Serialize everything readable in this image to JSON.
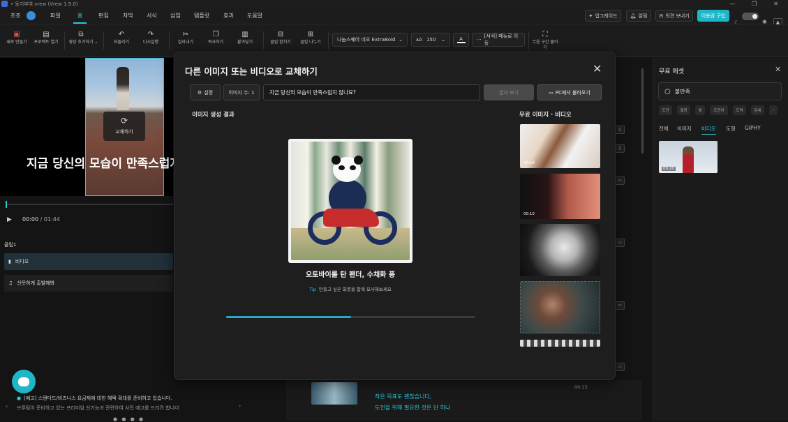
{
  "window": {
    "title": "• 동기부여.vrew (Vrew 1.9.0)"
  },
  "menu": {
    "user": "조조",
    "items": [
      "파일",
      "홈",
      "편집",
      "자막",
      "서식",
      "삽입",
      "템플릿",
      "효과",
      "도움말"
    ],
    "active_index": 1,
    "right_buttons": [
      "업그레이드",
      "알림",
      "의견 보내기",
      "이용권 구입"
    ]
  },
  "toolbar": {
    "tools": [
      {
        "label": "새로 만들기",
        "icon": "new-project"
      },
      {
        "label": "프로젝트 열기",
        "icon": "open-folder"
      },
      {
        "label": "영상 추가하기",
        "icon": "add-video"
      },
      {
        "label": "되돌리기",
        "icon": "undo"
      },
      {
        "label": "다시실행",
        "icon": "redo"
      },
      {
        "label": "잘라내기",
        "icon": "cut"
      },
      {
        "label": "복사하기",
        "icon": "copy"
      },
      {
        "label": "붙여넣기",
        "icon": "paste"
      },
      {
        "label": "클립 합치기",
        "icon": "merge"
      },
      {
        "label": "클립 나누기",
        "icon": "split"
      },
      {
        "label": "무음 구간 줄이기",
        "icon": "shrink-silence"
      }
    ],
    "font_name": "나눔스퀘어 네오 ExtraBold",
    "font_size": "150",
    "more_label": "[서식] 메뉴로 이동"
  },
  "editor": {
    "subtitle_text": "지금 당신의 모습이 만족스럽지",
    "replace_chip_label": "교체하기",
    "current_time": "00:00",
    "total_time": "/ 01:44",
    "clip_group": "클립1",
    "clip_rows": [
      "비디오",
      "산뜻하게 출발해봐"
    ]
  },
  "notice": {
    "line1": "[예고] 스탠다드/비즈니스 요금제에 대한 혜택 확대를 준비하고 있습니다.",
    "line2": "브루팀이 준비하고 있는 프리미엄 신기능과 관련하여 사전 예고를 드리려 합니다."
  },
  "bottom_strip": {
    "line1": "작은 목표도 괜찮습니다,",
    "line2": "도전을 위해 필요한 것은 단 하나",
    "duration": "00:15"
  },
  "right_panel": {
    "title": "무료 에셋",
    "search_value": "불만족",
    "chips": [
      "도전",
      "열정",
      "빛",
      "도전자",
      "도약",
      "운세"
    ],
    "tabs": [
      "전체",
      "이미지",
      "비디오",
      "도형",
      "GIPHY"
    ],
    "active_tab_index": 2,
    "thumb_duration": "00:20"
  },
  "modal": {
    "title": "다른 이미지 또는 비디오로 교체하기",
    "settings_label": "설정",
    "image_count_label": "이미지 수: 1",
    "prompt_value": "지금 당신의 모습이 만족스럽지 않나요?",
    "preview_label": "결과 보기",
    "upload_label": "PC에서 불러오기",
    "gen_result_label": "이미지 생성 결과",
    "free_label": "무료 이미지 · 비디오",
    "caption": "오토바이를 탄 팬더, 수채화 풍",
    "tip_tag": "Tip",
    "tip_text": "만들고 싶은 화풍을 함께 묘사해보세요",
    "progress": 0.5,
    "thumb_durations": [
      "00:18",
      "00:10"
    ]
  },
  "colors": {
    "accent": "#2ec5d6",
    "background": "#141414",
    "modal": "#1e1e1e"
  }
}
